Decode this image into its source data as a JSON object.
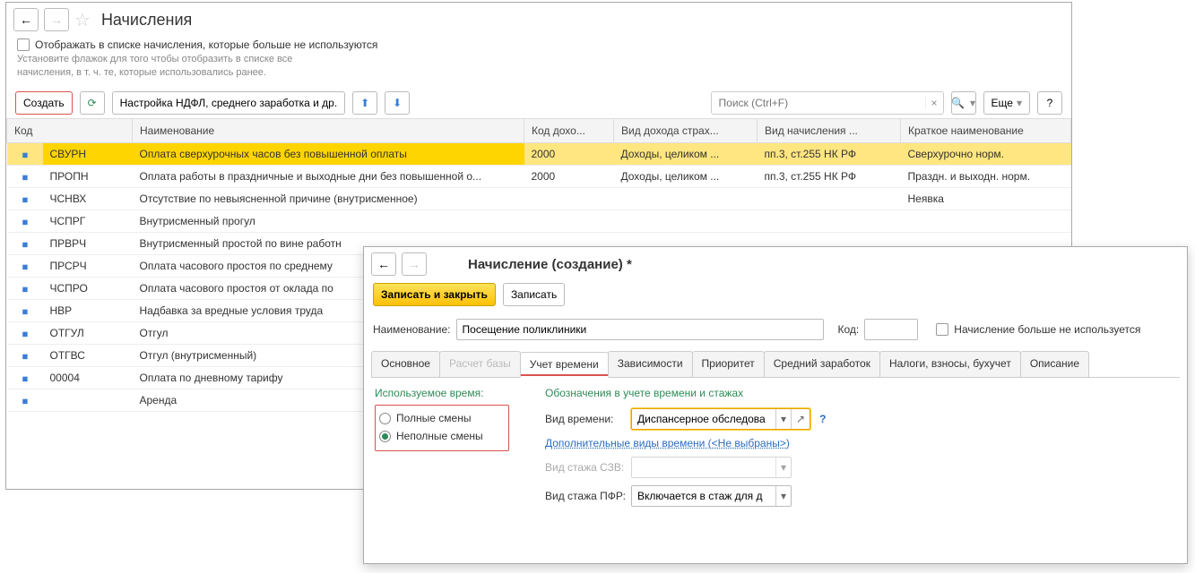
{
  "main": {
    "title": "Начисления",
    "checkbox_label": "Отображать в списке начисления, которые больше не используются",
    "hint": "Установите флажок для того чтобы отобразить в списке все начисления, в т. ч. те, которые использовались ранее.",
    "create": "Создать",
    "setup": "Настройка НДФЛ, среднего заработка и др.",
    "search_placeholder": "Поиск (Ctrl+F)",
    "more": "Еще",
    "columns": {
      "code": "Код",
      "name": "Наименование",
      "income_code": "Код дохо...",
      "income_type": "Вид дохода страх...",
      "accrual_type": "Вид начисления ...",
      "short_name": "Краткое наименование"
    },
    "rows": [
      {
        "code": "СВУРН",
        "name": "Оплата сверхурочных часов без повышенной оплаты",
        "inc": "2000",
        "itype": "Доходы, целиком ...",
        "atype": "пп.3, ст.255 НК РФ",
        "short": "Сверхурочно норм."
      },
      {
        "code": "ПРОПН",
        "name": "Оплата работы в праздничные и выходные дни без повышенной о...",
        "inc": "2000",
        "itype": "Доходы, целиком ...",
        "atype": "пп.3, ст.255 НК РФ",
        "short": "Праздн. и выходн. норм."
      },
      {
        "code": "ЧСНВХ",
        "name": "Отсутствие по невыясненной причине (внутрисменное)",
        "inc": "",
        "itype": "",
        "atype": "",
        "short": "Неявка"
      },
      {
        "code": "ЧСПРГ",
        "name": "Внутрисменный прогул",
        "inc": "",
        "itype": "",
        "atype": "",
        "short": ""
      },
      {
        "code": "ПРВРЧ",
        "name": "Внутрисменный простой по вине работн",
        "inc": "",
        "itype": "",
        "atype": "",
        "short": ""
      },
      {
        "code": "ПРСРЧ",
        "name": "Оплата часового простоя по среднему",
        "inc": "",
        "itype": "",
        "atype": "",
        "short": ""
      },
      {
        "code": "ЧСПРО",
        "name": "Оплата часового простоя от оклада по",
        "inc": "",
        "itype": "",
        "atype": "",
        "short": ""
      },
      {
        "code": "НВР",
        "name": "Надбавка за вредные условия труда",
        "inc": "",
        "itype": "",
        "atype": "",
        "short": ""
      },
      {
        "code": "ОТГУЛ",
        "name": "Отгул",
        "inc": "",
        "itype": "",
        "atype": "",
        "short": ""
      },
      {
        "code": "ОТГВС",
        "name": "Отгул (внутрисменный)",
        "inc": "",
        "itype": "",
        "atype": "",
        "short": ""
      },
      {
        "code": "00004",
        "name": "Оплата по дневному тарифу",
        "inc": "",
        "itype": "",
        "atype": "",
        "short": ""
      },
      {
        "code": "",
        "name": "Аренда",
        "inc": "",
        "itype": "",
        "atype": "",
        "short": ""
      }
    ]
  },
  "dialog": {
    "title": "Начисление (создание) *",
    "save_close": "Записать и закрыть",
    "save": "Записать",
    "name_label": "Наименование:",
    "name_value": "Посещение поликлиники",
    "code_label": "Код:",
    "inactive_label": "Начисление больше не используется",
    "tabs": [
      "Основное",
      "Расчет базы",
      "Учет времени",
      "Зависимости",
      "Приоритет",
      "Средний заработок",
      "Налоги, взносы, бухучет",
      "Описание"
    ],
    "left": {
      "section": "Используемое время:",
      "opt1": "Полные смены",
      "opt2": "Неполные смены"
    },
    "right": {
      "section": "Обозначения в учете времени и стажах",
      "time_type_label": "Вид времени:",
      "time_type_value": "Диспансерное обследова",
      "extra_link": "Дополнительные виды времени (<Не выбраны>)",
      "szv_label": "Вид стажа СЗВ:",
      "pfr_label": "Вид стажа ПФР:",
      "pfr_value": "Включается в стаж для д"
    }
  }
}
